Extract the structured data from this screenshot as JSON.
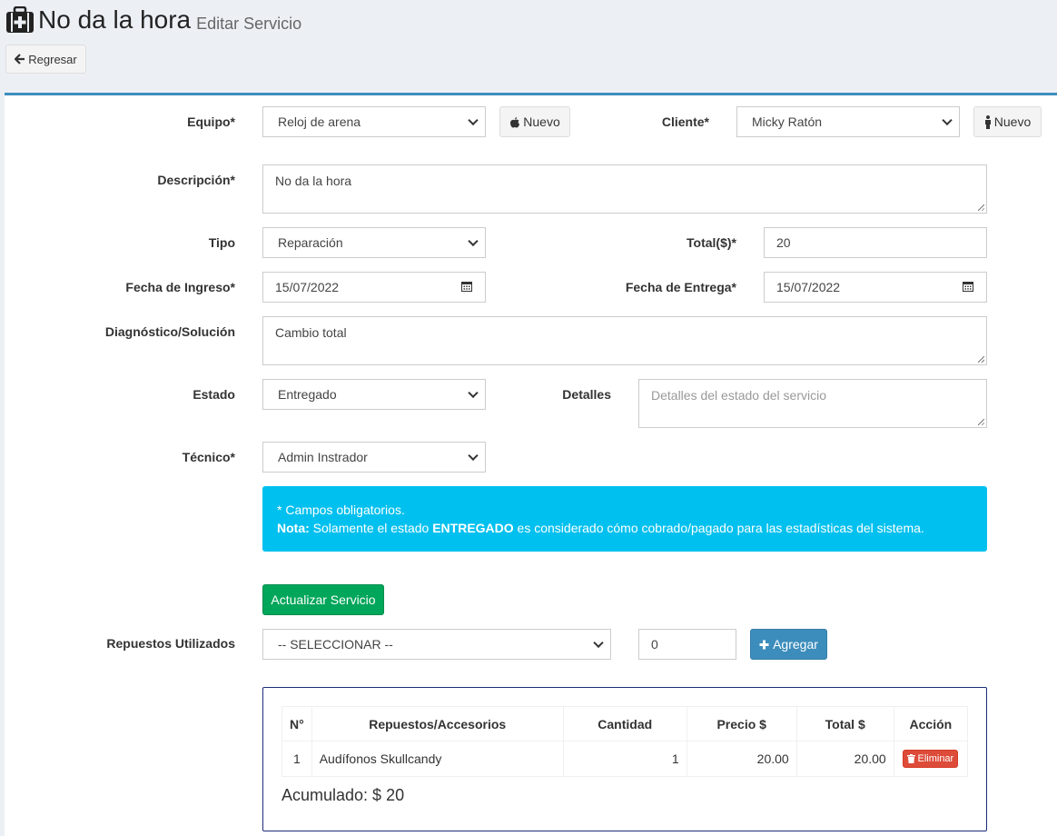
{
  "header": {
    "title": "No da la hora",
    "subtitle": "Editar Servicio",
    "back_label": "Regresar"
  },
  "form": {
    "equipo_label": "Equipo*",
    "equipo_value": "Reloj de arena",
    "equipo_new_label": "Nuevo",
    "cliente_label": "Cliente*",
    "cliente_value": "Micky Ratón",
    "cliente_new_label": "Nuevo",
    "descripcion_label": "Descripción*",
    "descripcion_value": "No da la hora",
    "tipo_label": "Tipo",
    "tipo_value": "Reparación",
    "total_label": "Total($)*",
    "total_value": "20",
    "fecha_ingreso_label": "Fecha de Ingreso*",
    "fecha_ingreso_value": "15/07/2022",
    "fecha_entrega_label": "Fecha de Entrega*",
    "fecha_entrega_value": "15/07/2022",
    "diagnostico_label": "Diagnóstico/Solución",
    "diagnostico_value": "Cambio total",
    "estado_label": "Estado",
    "estado_value": "Entregado",
    "detalles_label": "Detalles",
    "detalles_placeholder": "Detalles del estado del servicio",
    "tecnico_label": "Técnico*",
    "tecnico_value": "Admin Instrador"
  },
  "callout": {
    "line1": "* Campos obligatorios.",
    "nota_bold": "Nota:",
    "nota_text1": " Solamente el estado ",
    "nota_strong": "ENTREGADO",
    "nota_text2": " es considerado cómo cobrado/pagado para las estadísticas del sistema."
  },
  "actions": {
    "update_label": "Actualizar Servicio"
  },
  "repuestos": {
    "label": "Repuestos Utilizados",
    "select_value": "-- SELECCIONAR --",
    "qty_value": "0",
    "add_label": "Agregar"
  },
  "table": {
    "headers": [
      "N°",
      "Repuestos/Accesorios",
      "Cantidad",
      "Precio $",
      "Total $",
      "Acción"
    ],
    "rows": [
      {
        "n": "1",
        "item": "Audífonos Skullcandy",
        "qty": "1",
        "price": "20.00",
        "total": "20.00",
        "action": "Eliminar"
      }
    ],
    "accumulated": "Acumulado: $ 20"
  },
  "colors": {
    "accent": "#3c8dbc",
    "info": "#00c0ef",
    "success": "#00a65a",
    "danger": "#dd4b39"
  }
}
